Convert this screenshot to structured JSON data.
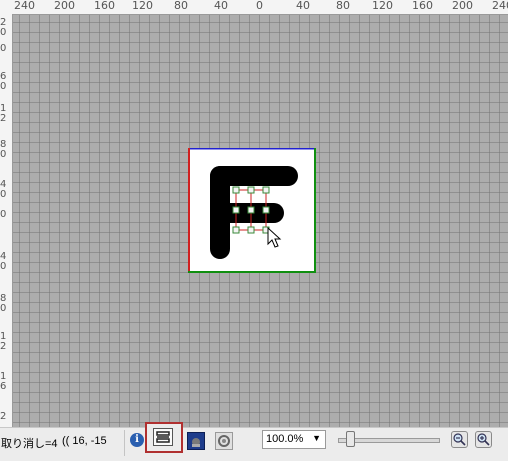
{
  "ruler": {
    "top_labels": [
      "240",
      "200",
      "160",
      "120",
      "80",
      "40",
      "0",
      "40",
      "80",
      "120",
      "160",
      "200",
      "240"
    ],
    "left_labels": [
      "2\n0",
      "0",
      "6\n0",
      "1\n2",
      "8\n0",
      "4\n0",
      "0",
      "4\n0",
      "8\n0",
      "1\n2",
      "1\n6",
      "2"
    ]
  },
  "statusbar": {
    "undo": "取り消し=4",
    "coords": "(( 16, -15",
    "zoom_value": "100.0%",
    "info_glyph": "i",
    "zoom_level": 0.08
  },
  "colors": {
    "canvas_bg": "#adadad",
    "baseline_blue": "#2020d0",
    "left_red": "#d02020",
    "right_green": "#109010",
    "glyph": "#000000",
    "selection_red": "#cc2222",
    "handle_green": "#3a8a3a"
  },
  "icons": {
    "info": "info-icon",
    "snap": "snap-toggle-icon",
    "tool2": "fill-tool-icon",
    "tool3": "gear-icon",
    "zoom_out": "zoom-out-icon",
    "zoom_in": "zoom-in-icon",
    "cursor": "mouse-cursor-icon"
  }
}
